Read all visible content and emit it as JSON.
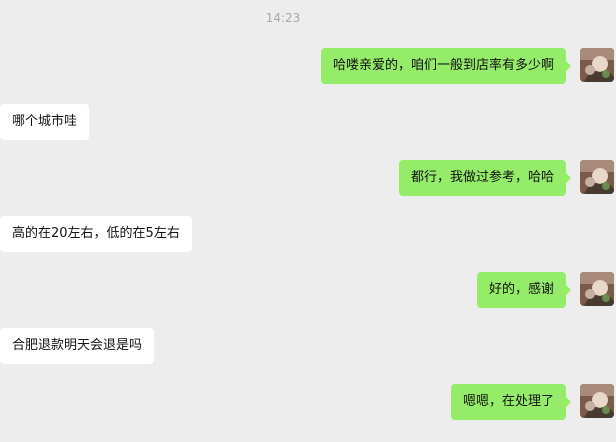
{
  "chat": {
    "timestamp": "14:23",
    "avatar_icon": "user-avatar-icon",
    "colors": {
      "background": "#ededed",
      "outgoing_bubble": "#95ec69",
      "incoming_bubble": "#ffffff",
      "timestamp_text": "#a8a8a8"
    },
    "messages": [
      {
        "direction": "outgoing",
        "text": "哈喽亲爱的，咱们一般到店率有多少啊"
      },
      {
        "direction": "incoming",
        "text": "哪个城市哇"
      },
      {
        "direction": "outgoing",
        "text": "都行，我做过参考，哈哈"
      },
      {
        "direction": "incoming",
        "text": "高的在20左右，低的在5左右"
      },
      {
        "direction": "outgoing",
        "text": "好的，感谢"
      },
      {
        "direction": "incoming",
        "text": "合肥退款明天会退是吗"
      },
      {
        "direction": "outgoing",
        "text": "嗯嗯，在处理了"
      }
    ]
  }
}
